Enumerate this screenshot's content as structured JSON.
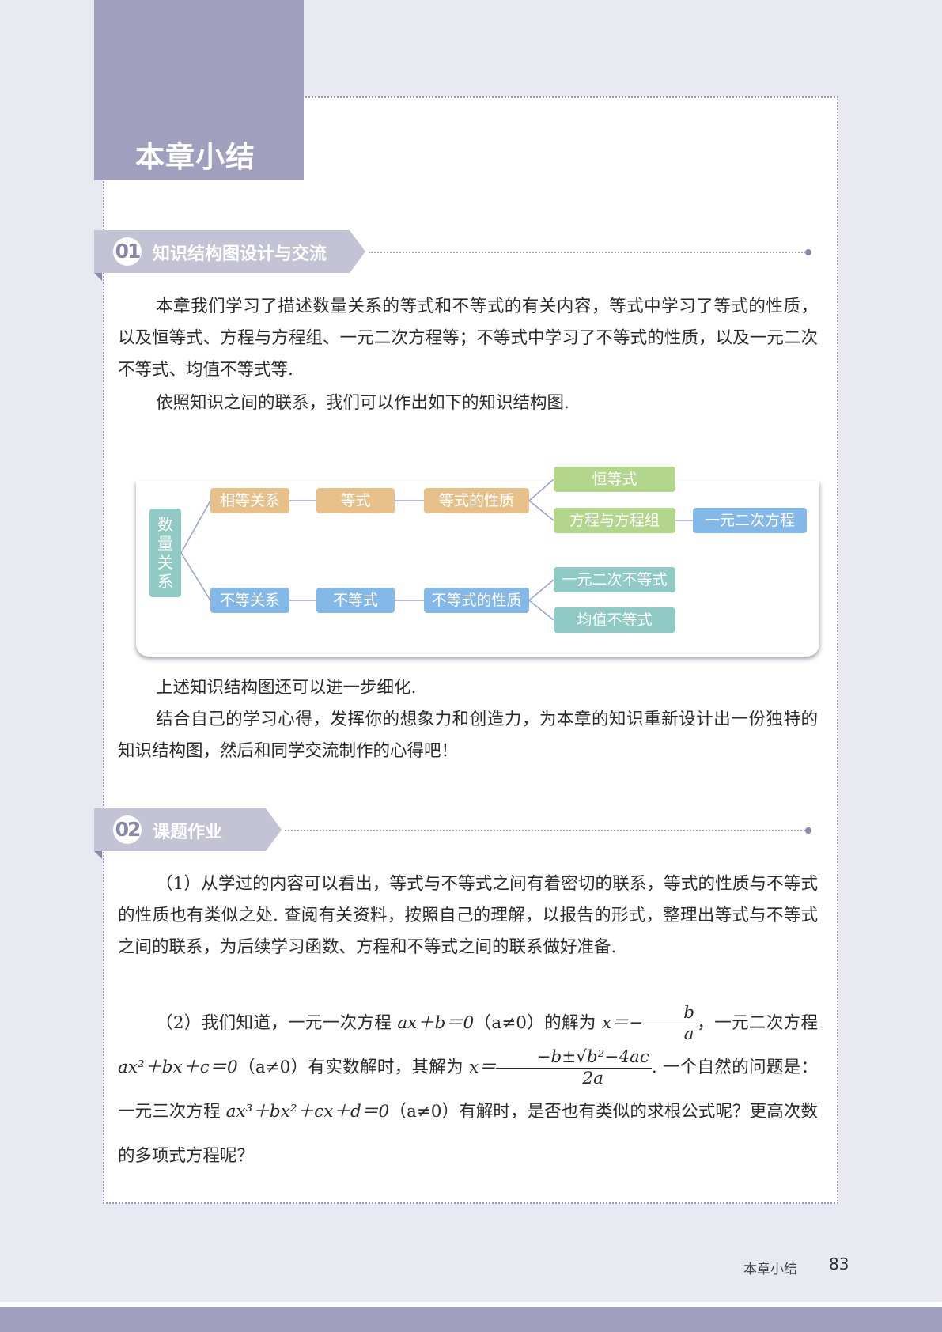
{
  "chapter": {
    "title": "本章小结"
  },
  "section1": {
    "number": "01",
    "title": "知识结构图设计与交流",
    "p1": "本章我们学习了描述数量关系的等式和不等式的有关内容，等式中学习了等式的性质，以及恒等式、方程与方程组、一元二次方程等；不等式中学习了不等式的性质，以及一元二次不等式、均值不等式等.",
    "p2": "依照知识之间的联系，我们可以作出如下的知识结构图.",
    "p3": "上述知识结构图还可以进一步细化.",
    "p4": "结合自己的学习心得，发挥你的想象力和创造力，为本章的知识重新设计出一份独特的知识结构图，然后和同学交流制作的心得吧！"
  },
  "diagram": {
    "root": [
      "数",
      "量",
      "关",
      "系"
    ],
    "equal_relation": "相等关系",
    "equation": "等式",
    "equation_props": "等式的性质",
    "identity": "恒等式",
    "eq_systems": "方程与方程组",
    "quadratic_eq": "一元二次方程",
    "unequal_relation": "不等关系",
    "inequality": "不等式",
    "inequality_props": "不等式的性质",
    "quadratic_ineq": "一元二次不等式",
    "mean_ineq": "均值不等式",
    "colors": {
      "orange": "#e8c08a",
      "green": "#b3d68d",
      "blue": "#84b8e8",
      "teal": "#8fcbc4",
      "line": "#9aa6d6"
    }
  },
  "section2": {
    "number": "02",
    "title": "课题作业",
    "item1": "（1）从学过的内容可以看出，等式与不等式之间有着密切的联系，等式的性质与不等式的性质也有类似之处. 查阅有关资料，按照自己的理解，以报告的形式，整理出等式与不等式之间的联系，为后续学习函数、方程和不等式之间的联系做好准备.",
    "item2": {
      "t1": "（2）我们知道，一元一次方程 ",
      "eq1": "ax＋b＝0",
      "c1": "（a≠0）",
      "t2": "的解为 ",
      "sol1_lhs": "x＝−",
      "sol1_num": "b",
      "sol1_den": "a",
      "t3": "，一元二次方程 ",
      "eq2": "ax²＋bx＋c＝0",
      "c2": "（a≠0）",
      "t4": "有实数解时，其解为 ",
      "sol2_lhs": "x＝",
      "sol2_num": "−b±√b²−4ac",
      "sol2_den": "2a",
      "t5": ". 一个自然的问题是：一元三次方程 ",
      "eq3": "ax³＋bx²＋cx＋d＝0",
      "c3": "（a≠0）",
      "t6": "有解时，是否也有类似的求根公式呢？更高次数的多项式方程呢？"
    }
  },
  "footer": {
    "label": "本章小结",
    "page": "83"
  },
  "theme": {
    "accent": "#a09fbd",
    "banner": "#c4c3d6"
  }
}
